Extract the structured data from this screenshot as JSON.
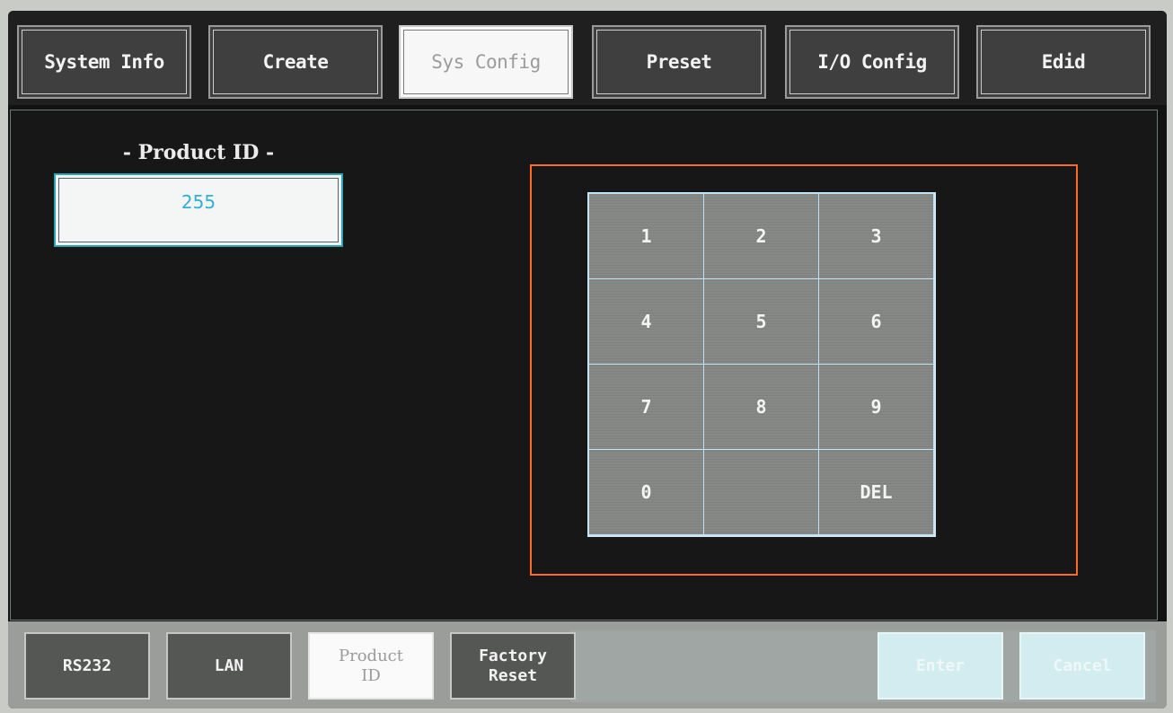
{
  "tabs": [
    {
      "label": "System Info",
      "active": false
    },
    {
      "label": "Create",
      "active": false
    },
    {
      "label": "Sys Config",
      "active": true
    },
    {
      "label": "Preset",
      "active": false
    },
    {
      "label": "I/O Config",
      "active": false
    },
    {
      "label": "Edid",
      "active": false
    }
  ],
  "product_id": {
    "label": "- Product ID -",
    "value": "255"
  },
  "keypad": {
    "keys": [
      "1",
      "2",
      "3",
      "4",
      "5",
      "6",
      "7",
      "8",
      "9",
      "0",
      "",
      "DEL"
    ]
  },
  "bottom": {
    "rs232": "RS232",
    "lan": "LAN",
    "product_id_line1": "Product",
    "product_id_line2": "ID",
    "factory_reset_line1": "Factory",
    "factory_reset_line2": "Reset",
    "enter": "Enter",
    "cancel": "Cancel"
  },
  "colors": {
    "accent_orange": "#ff6a26",
    "field_border": "#2aa7b4",
    "field_text": "#2fb0d4"
  }
}
